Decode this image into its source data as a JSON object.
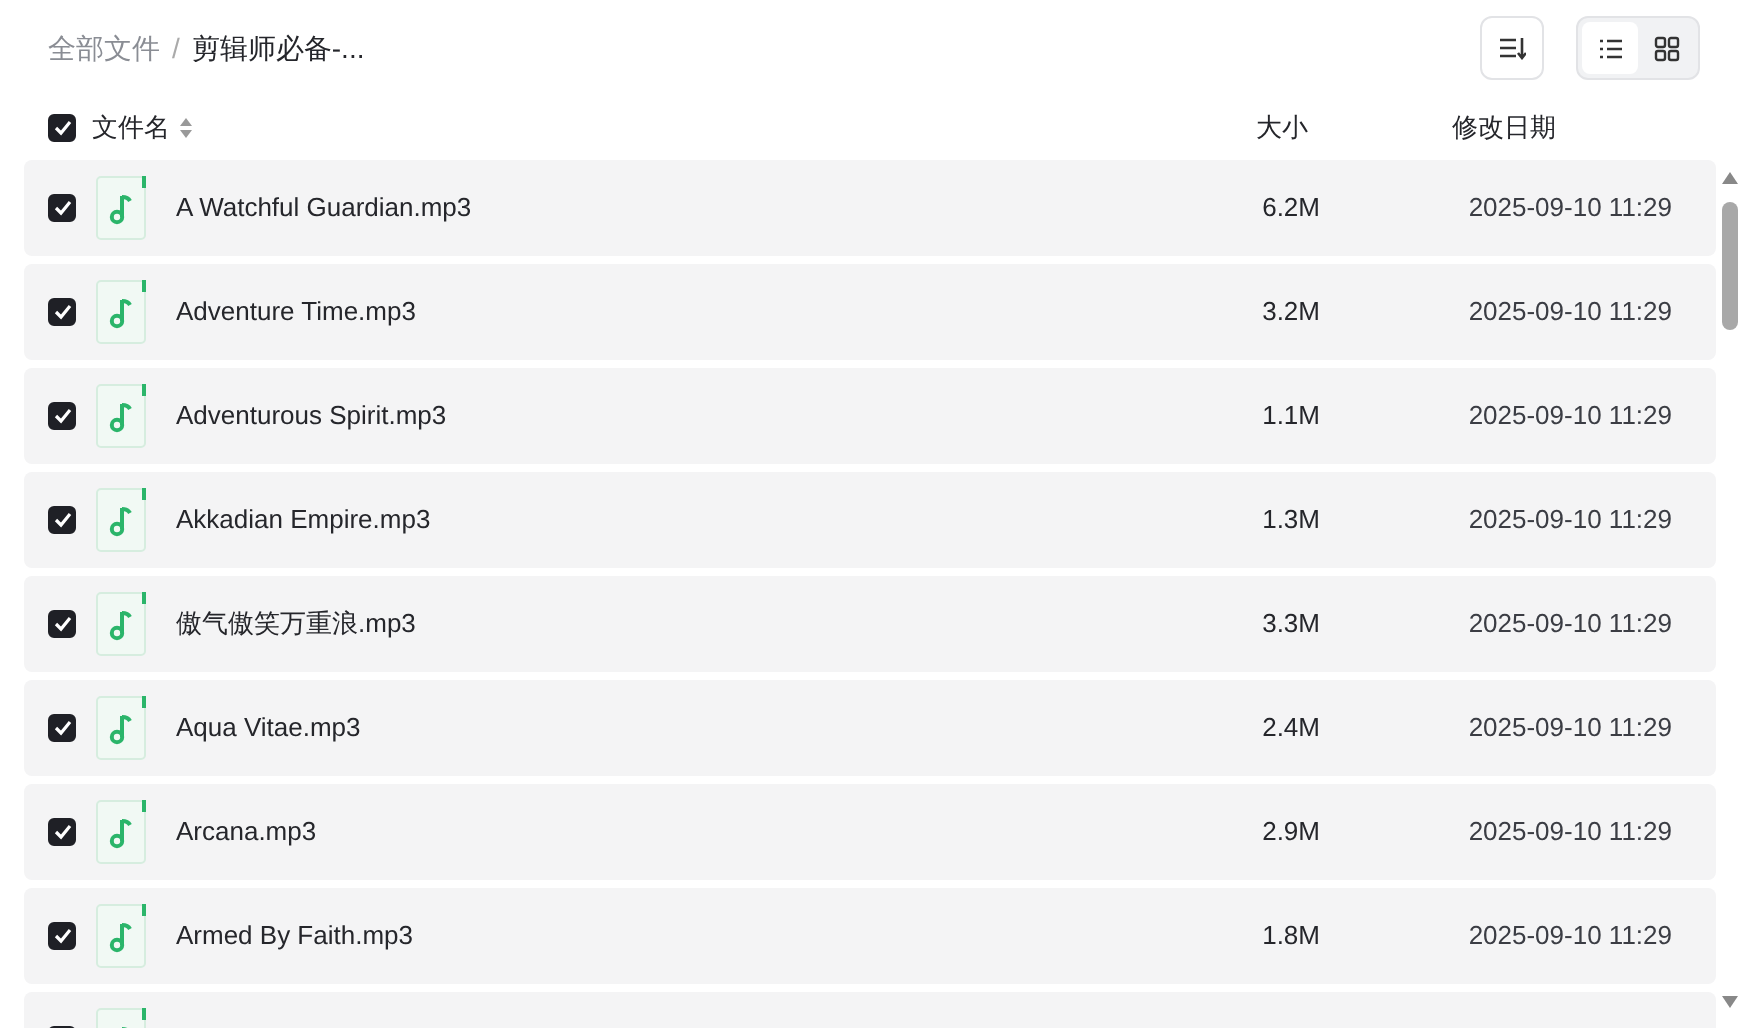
{
  "breadcrumb_separator": "/",
  "breadcrumb": [
    {
      "label": "全部文件",
      "current": false
    },
    {
      "label": "剪辑师必备-...",
      "current": true
    }
  ],
  "view_toggle": [
    {
      "kind": "list",
      "selected": true
    },
    {
      "kind": "grid",
      "selected": false
    }
  ],
  "header": {
    "checked": true,
    "name": "文件名",
    "size": "大小",
    "date": "修改日期"
  },
  "files": [
    {
      "checked": true,
      "name": "A Watchful Guardian.mp3",
      "size": "6.2M",
      "date": "2025-09-10 11:29"
    },
    {
      "checked": true,
      "name": "Adventure Time.mp3",
      "size": "3.2M",
      "date": "2025-09-10 11:29"
    },
    {
      "checked": true,
      "name": "Adventurous Spirit.mp3",
      "size": "1.1M",
      "date": "2025-09-10 11:29"
    },
    {
      "checked": true,
      "name": "Akkadian Empire.mp3",
      "size": "1.3M",
      "date": "2025-09-10 11:29"
    },
    {
      "checked": true,
      "name": "傲气傲笑万重浪.mp3",
      "size": "3.3M",
      "date": "2025-09-10 11:29"
    },
    {
      "checked": true,
      "name": "Aqua Vitae.mp3",
      "size": "2.4M",
      "date": "2025-09-10 11:29"
    },
    {
      "checked": true,
      "name": "Arcana.mp3",
      "size": "2.9M",
      "date": "2025-09-10 11:29"
    },
    {
      "checked": true,
      "name": "Armed By Faith.mp3",
      "size": "1.8M",
      "date": "2025-09-10 11:29"
    },
    {
      "checked": true
    }
  ]
}
